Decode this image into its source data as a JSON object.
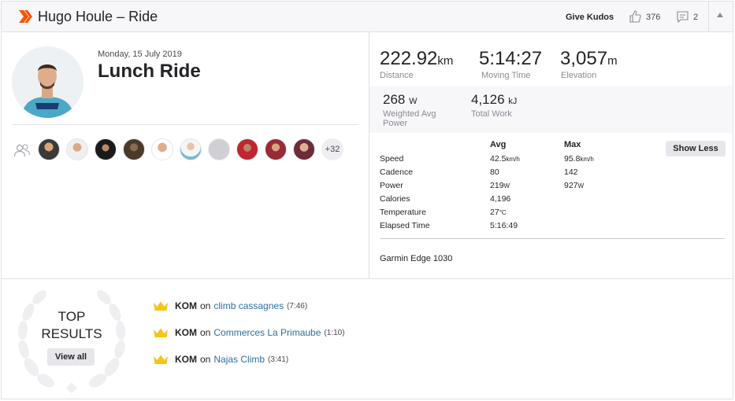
{
  "header": {
    "title": "Hugo Houle – Ride",
    "give_kudos": "Give Kudos",
    "kudos_count": "376",
    "comment_count": "2"
  },
  "activity": {
    "date": "Monday, 15 July 2019",
    "name": "Lunch Ride",
    "more_athletes": "+32"
  },
  "primary_stats": [
    {
      "value": "222.92",
      "unit": "km",
      "label": "Distance"
    },
    {
      "value": "5:14:27",
      "unit": "",
      "label": "Moving Time"
    },
    {
      "value": "3,057",
      "unit": "m",
      "label": "Elevation"
    }
  ],
  "secondary_stats": [
    {
      "value": "268",
      "unit": "W",
      "label_line1": "Weighted Avg",
      "label_line2": "Power"
    },
    {
      "value": "4,126",
      "unit": "kJ",
      "label_line1": "Total Work",
      "label_line2": ""
    }
  ],
  "details": {
    "col_avg": "Avg",
    "col_max": "Max",
    "show_less": "Show Less",
    "rows": [
      {
        "label": "Speed",
        "avg": "42.5",
        "avg_unit": "km/h",
        "max": "95.8",
        "max_unit": "km/h"
      },
      {
        "label": "Cadence",
        "avg": "80",
        "avg_unit": "",
        "max": "142",
        "max_unit": ""
      },
      {
        "label": "Power",
        "avg": "219",
        "avg_unit": "W",
        "max": "927",
        "max_unit": "W"
      },
      {
        "label": "Calories",
        "avg": "4,196",
        "avg_unit": "",
        "max": "",
        "max_unit": ""
      },
      {
        "label": "Temperature",
        "avg": "27",
        "avg_unit": "°C",
        "max": "",
        "max_unit": ""
      },
      {
        "label": "Elapsed Time",
        "avg": "5:16:49",
        "avg_unit": "",
        "max": "",
        "max_unit": ""
      }
    ],
    "device": "Garmin Edge 1030"
  },
  "top_results": {
    "heading_line1": "TOP",
    "heading_line2": "RESULTS",
    "view_all": "View all",
    "items": [
      {
        "badge": "KOM",
        "on": "on",
        "segment": "climb cassagnes",
        "time": "(7:46)"
      },
      {
        "badge": "KOM",
        "on": "on",
        "segment": "Commerces La Primaube",
        "time": "(1:10)"
      },
      {
        "badge": "KOM",
        "on": "on",
        "segment": "Najas Climb",
        "time": "(3:41)"
      }
    ]
  },
  "colors": {
    "brand": "#fc5200",
    "link": "#2e6f9e",
    "crown": "#f5c518",
    "header_bg": "#f7f7fa"
  }
}
